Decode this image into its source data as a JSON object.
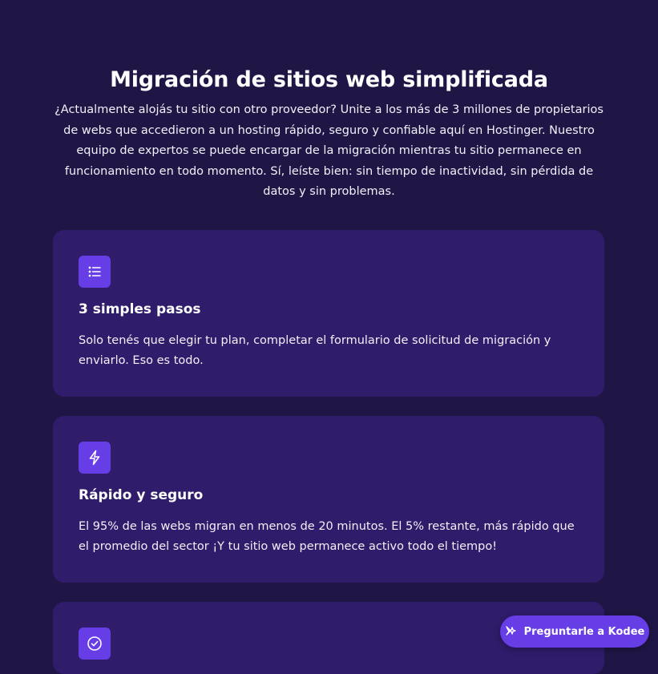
{
  "section": {
    "title": "Migración de sitios web simplificada",
    "intro": "¿Actualmente alojás tu sitio con otro proveedor? Unite a los más de 3 millones de propietarios de webs que accedieron a un hosting rápido, seguro y confiable aquí en Hostinger. Nuestro equipo de expertos se puede encargar de la migración mientras tu sitio permanece en funcionamiento en todo momento. Sí, leíste bien: sin tiempo de inactividad, sin pérdida de datos y sin problemas."
  },
  "cards": [
    {
      "icon": "list-icon",
      "title": "3 simples pasos",
      "text": "Solo tenés que elegir tu plan, completar el formulario de solicitud de migración y enviarlo. Eso es todo."
    },
    {
      "icon": "lightning-icon",
      "title": "Rápido y seguro",
      "text": "El 95% de las webs migran en menos de 20 minutos. El 5% restante, más rápido que el promedio del sector ¡Y tu sitio web permanece activo todo el tiempo!"
    },
    {
      "icon": "check-circle-icon"
    }
  ],
  "assistant": {
    "label": "Preguntarle a Kodee",
    "icon": "sparkle-icon"
  },
  "colors": {
    "background": "#1f1646",
    "card": "#2f1c6a",
    "accent": "#673de6"
  }
}
